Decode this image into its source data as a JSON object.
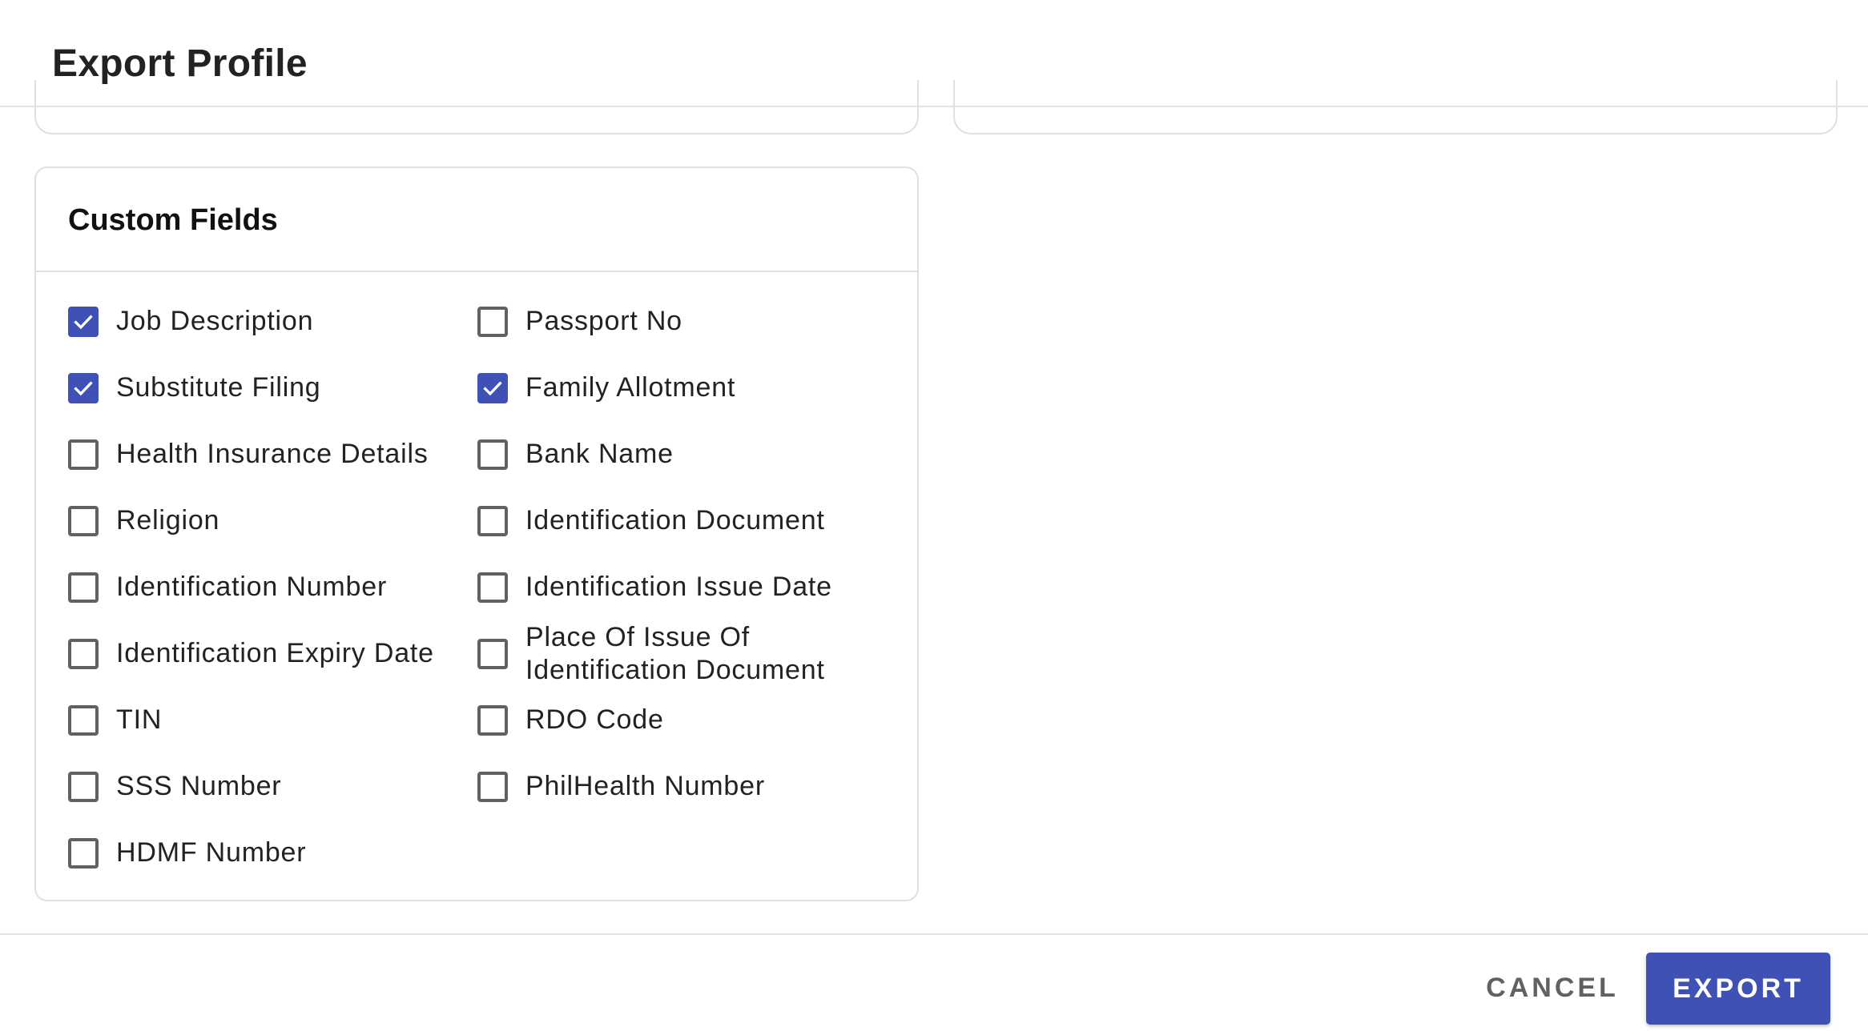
{
  "dialog": {
    "title": "Export Profile"
  },
  "custom_fields": {
    "title": "Custom Fields",
    "items": [
      {
        "label": "Job Description",
        "checked": true
      },
      {
        "label": "Passport No",
        "checked": false
      },
      {
        "label": "Substitute Filing",
        "checked": true
      },
      {
        "label": "Family Allotment",
        "checked": true
      },
      {
        "label": "Health Insurance Details",
        "checked": false
      },
      {
        "label": "Bank Name",
        "checked": false
      },
      {
        "label": "Religion",
        "checked": false
      },
      {
        "label": "Identification Document",
        "checked": false
      },
      {
        "label": "Identification Number",
        "checked": false
      },
      {
        "label": "Identification Issue Date",
        "checked": false
      },
      {
        "label": "Identification Expiry Date",
        "checked": false
      },
      {
        "label": "Place Of Issue Of Identification Document",
        "checked": false
      },
      {
        "label": "TIN",
        "checked": false
      },
      {
        "label": "RDO Code",
        "checked": false
      },
      {
        "label": "SSS Number",
        "checked": false
      },
      {
        "label": "PhilHealth Number",
        "checked": false
      },
      {
        "label": "HDMF Number",
        "checked": false
      }
    ]
  },
  "footer": {
    "cancel_label": "CANCEL",
    "export_label": "EXPORT"
  },
  "colors": {
    "accent": "#3f51b5",
    "unchecked_border": "#616161",
    "divider": "#e0e0e0"
  }
}
